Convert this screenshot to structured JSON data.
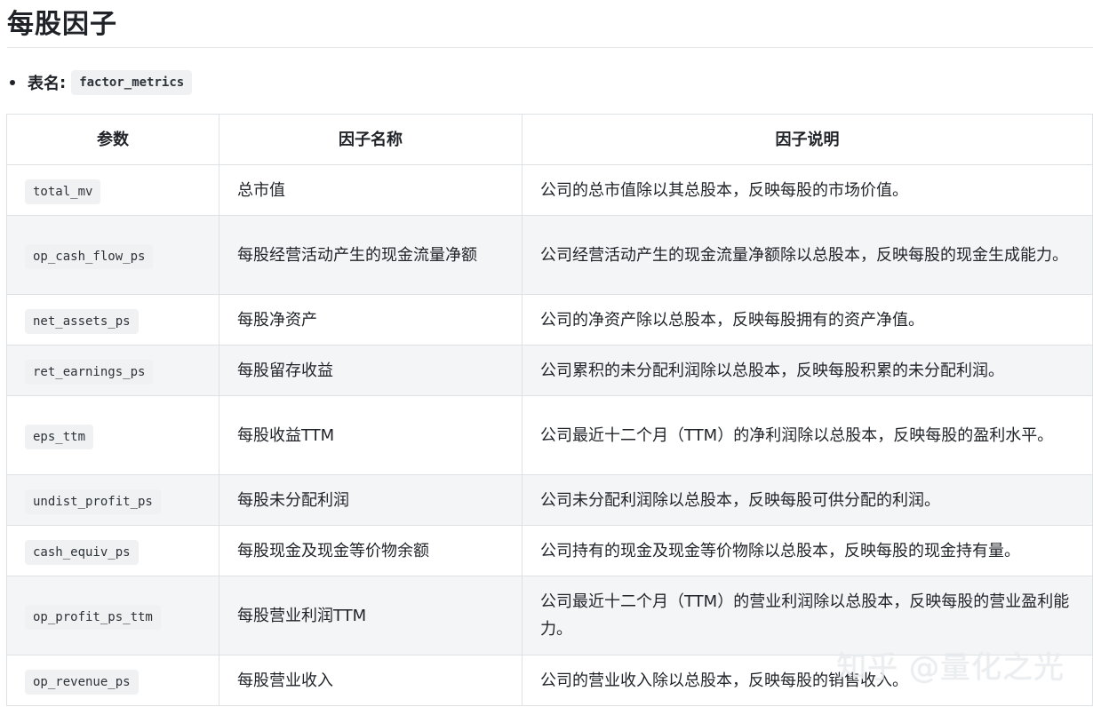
{
  "title": "每股因子",
  "meta": {
    "label": "表名",
    "colon": ":",
    "table_name": "factor_metrics"
  },
  "table": {
    "headers": [
      "参数",
      "因子名称",
      "因子说明"
    ],
    "rows": [
      {
        "param": "total_mv",
        "name": "总市值",
        "desc": "公司的总市值除以其总股本，反映每股的市场价值。"
      },
      {
        "param": "op_cash_flow_ps",
        "name": "每股经营活动产生的现金流量净额",
        "desc": "公司经营活动产生的现金流量净额除以总股本，反映每股的现金生成能力。"
      },
      {
        "param": "net_assets_ps",
        "name": "每股净资产",
        "desc": "公司的净资产除以总股本，反映每股拥有的资产净值。"
      },
      {
        "param": "ret_earnings_ps",
        "name": "每股留存收益",
        "desc": "公司累积的未分配利润除以总股本，反映每股积累的未分配利润。"
      },
      {
        "param": "eps_ttm",
        "name": "每股收益TTM",
        "desc": "公司最近十二个月（TTM）的净利润除以总股本，反映每股的盈利水平。"
      },
      {
        "param": "undist_profit_ps",
        "name": "每股未分配利润",
        "desc": "公司未分配利润除以总股本，反映每股可供分配的利润。"
      },
      {
        "param": "cash_equiv_ps",
        "name": "每股现金及现金等价物余额",
        "desc": "公司持有的现金及现金等价物除以总股本，反映每股的现金持有量。"
      },
      {
        "param": "op_profit_ps_ttm",
        "name": "每股营业利润TTM",
        "desc": "公司最近十二个月（TTM）的营业利润除以总股本，反映每股的营业盈利能力。"
      },
      {
        "param": "op_revenue_ps",
        "name": "每股营业收入",
        "desc": "公司的营业收入除以总股本，反映每股的销售收入。"
      }
    ]
  },
  "watermark": "知乎 @量化之光"
}
